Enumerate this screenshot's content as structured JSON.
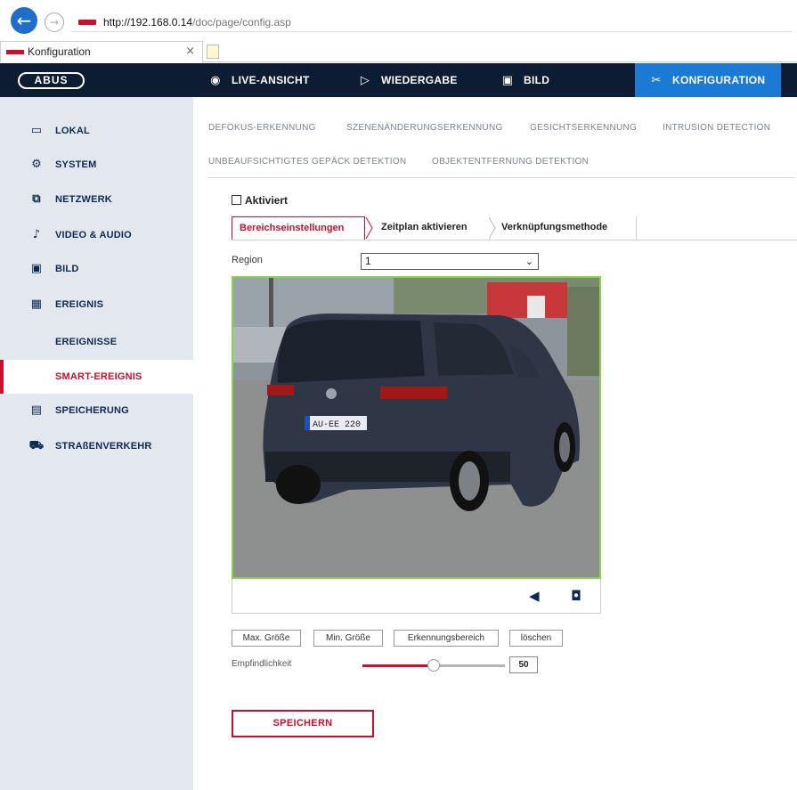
{
  "browser": {
    "url_host": "http://192.168.0.14",
    "url_path": "/doc/page/config.asp",
    "tab_title": "Konfiguration",
    "tab_close": "×",
    "back_glyph": "←",
    "forward_glyph": "→"
  },
  "topnav": {
    "logo": "ABUS",
    "items": [
      {
        "label": "LIVE-ANSICHT",
        "icon": "eye-icon",
        "glyph": "◉"
      },
      {
        "label": "WIEDERGABE",
        "icon": "play-icon",
        "glyph": "▷"
      },
      {
        "label": "BILD",
        "icon": "image-icon",
        "glyph": "▣"
      },
      {
        "label": "KONFIGURATION",
        "icon": "tools-icon",
        "glyph": "✂",
        "active": true
      }
    ]
  },
  "sidebar": {
    "items": [
      {
        "label": "LOKAL",
        "icon": "monitor-icon",
        "glyph": "▭"
      },
      {
        "label": "SYSTEM",
        "icon": "gear-icon",
        "glyph": "⚙"
      },
      {
        "label": "NETZWERK",
        "icon": "network-icon",
        "glyph": "⧉"
      },
      {
        "label": "VIDEO & AUDIO",
        "icon": "microphone-icon",
        "glyph": "♪"
      },
      {
        "label": "BILD",
        "icon": "image-icon",
        "glyph": "▣"
      },
      {
        "label": "EREIGNIS",
        "icon": "calendar-icon",
        "glyph": "▦"
      },
      {
        "label": "EREIGNISSE",
        "sub": true
      },
      {
        "label": "SMART-EREIGNIS",
        "sub": true,
        "active": true
      },
      {
        "label": "SPEICHERUNG",
        "icon": "storage-icon",
        "glyph": "▤"
      },
      {
        "label": "STRAßENVERKEHR",
        "icon": "traffic-icon",
        "glyph": "⛟"
      }
    ]
  },
  "subtabs": [
    "DEFOKUS-ERKENNUNG",
    "SZENENÄNDERUNGSERKENNUNG",
    "GESICHTSERKENNUNG",
    "INTRUSION DETECTION",
    "UNBEAUFSICHTIGTES GEPÄCK DETEKTION",
    "OBJEKTENTFERNUNG DETEKTION"
  ],
  "form": {
    "activated_label": "Aktiviert",
    "tabs": [
      "Bereichseinstellungen",
      "Zeitplan aktivieren",
      "Verknüpfungsmethode"
    ],
    "region_label": "Region",
    "region_value": "1",
    "buttons": [
      "Max. Größe",
      "Min. Größe",
      "Erkennungsbereich",
      "löschen"
    ],
    "sensitivity_label": "Empfindlichkeit",
    "sensitivity_value": "50",
    "sensitivity_fraction": 0.5,
    "save_label": "SPEICHERN"
  },
  "video": {
    "plate_text": "AU·EE 220",
    "toolbar": [
      {
        "icon": "record-icon",
        "glyph": "◀"
      },
      {
        "icon": "camera-icon",
        "glyph": "◘"
      }
    ]
  },
  "colors": {
    "accent": "#c8102e",
    "nav_bg": "#0c1c33",
    "nav_active": "#1a7ad4",
    "sidebar_bg": "#e3e8ee",
    "video_border": "#8bd34a"
  }
}
